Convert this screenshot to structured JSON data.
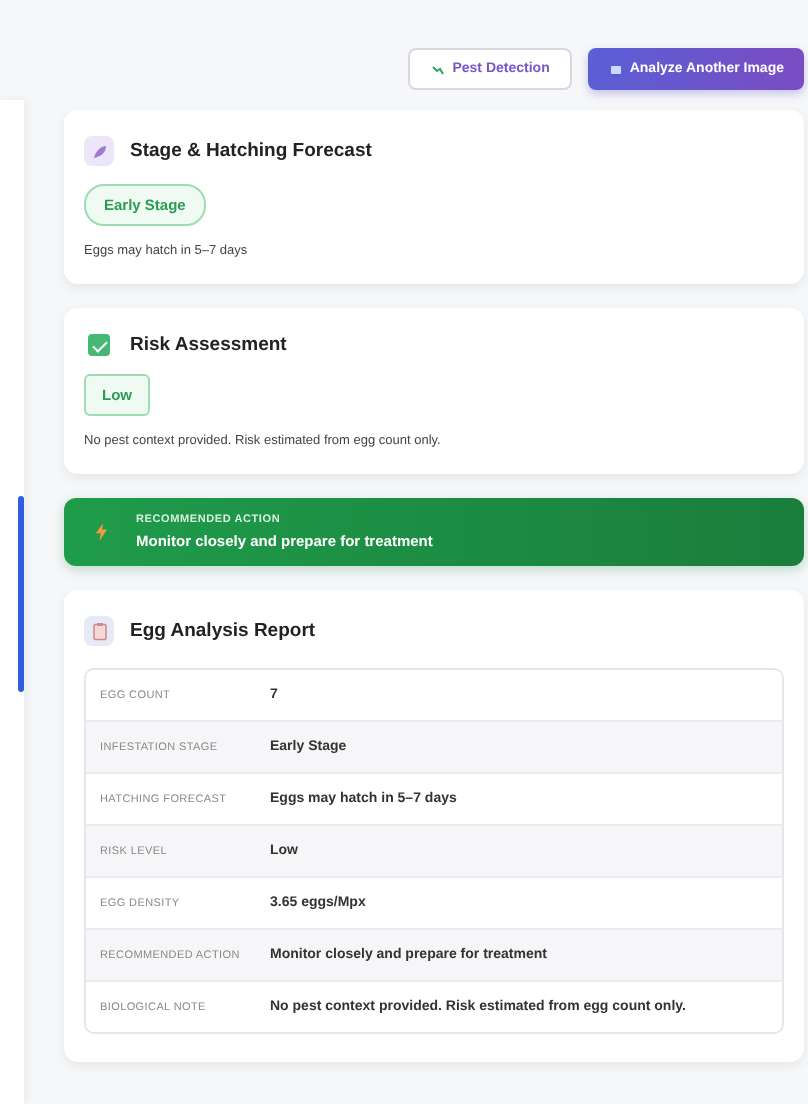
{
  "toolbar": {
    "buttons": [
      {
        "label": "Pest Detection",
        "kind": "outline"
      },
      {
        "label": "Analyze Another Image",
        "kind": "primary"
      }
    ]
  },
  "stage_card": {
    "title": "Stage & Hatching Forecast",
    "badge": "Early Stage",
    "note": "Eggs may hatch in 5–7 days"
  },
  "risk_card": {
    "title": "Risk Assessment",
    "checked": true,
    "badge": "Low",
    "note": "No pest context provided. Risk estimated from egg count only."
  },
  "action_banner": {
    "label": "RECOMMENDED ACTION",
    "text": "Monitor closely and prepare for treatment"
  },
  "report": {
    "title": "Egg Analysis Report",
    "rows": [
      {
        "label": "EGG COUNT",
        "value": "7"
      },
      {
        "label": "INFESTATION STAGE",
        "value": "Early Stage"
      },
      {
        "label": "HATCHING FORECAST",
        "value": "Eggs may hatch in 5–7 days"
      },
      {
        "label": "RISK LEVEL",
        "value": "Low"
      },
      {
        "label": "EGG DENSITY",
        "value": "3.65 eggs/Mpx"
      },
      {
        "label": "RECOMMENDED ACTION",
        "value": "Monitor closely and prepare for treatment"
      },
      {
        "label": "BIOLOGICAL NOTE",
        "value": "No pest context provided. Risk estimated from egg count only."
      }
    ]
  }
}
